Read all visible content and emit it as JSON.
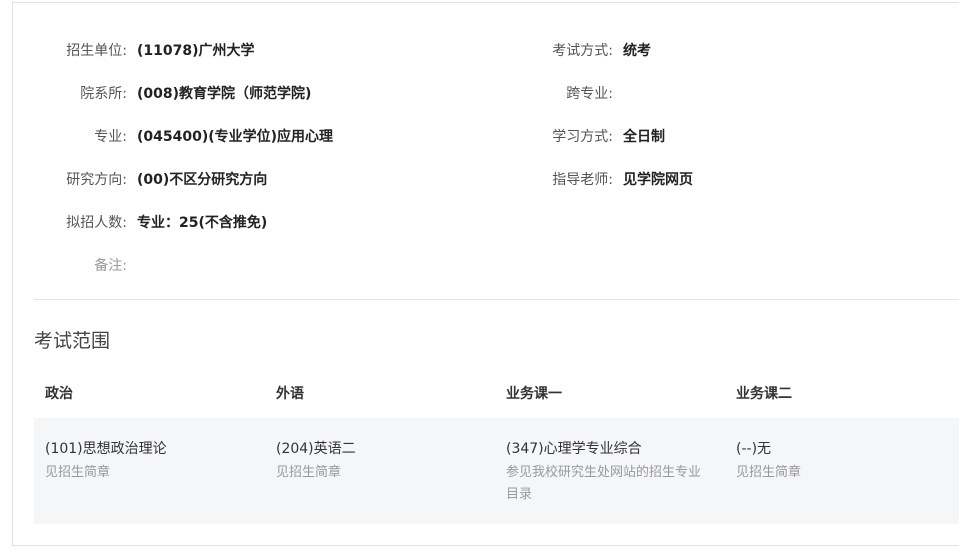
{
  "info": {
    "left": [
      {
        "label": "招生单位:",
        "value": "(11078)广州大学"
      },
      {
        "label": "院系所:",
        "value": "(008)教育学院（师范学院)"
      },
      {
        "label": "专业:",
        "value": "(045400)(专业学位)应用心理"
      },
      {
        "label": "研究方向:",
        "value": "(00)不区分研究方向"
      },
      {
        "label": "拟招人数:",
        "value": "专业：25(不含推免)"
      },
      {
        "label": "备注:",
        "value": ""
      }
    ],
    "right": [
      {
        "label": "考试方式:",
        "value": "统考"
      },
      {
        "label": "跨专业:",
        "value": ""
      },
      {
        "label": "学习方式:",
        "value": "全日制"
      },
      {
        "label": "指导老师:",
        "value": "见学院网页"
      }
    ]
  },
  "exam_scope": {
    "title": "考试范围",
    "headers": [
      "政治",
      "外语",
      "业务课一",
      "业务课二"
    ],
    "rows": [
      [
        {
          "subject": "(101)思想政治理论",
          "note": "见招生简章"
        },
        {
          "subject": "(204)英语二",
          "note": "见招生简章"
        },
        {
          "subject": "(347)心理学专业综合",
          "note": "参见我校研究生处网站的招生专业目录"
        },
        {
          "subject": "(--)无",
          "note": "见招生简章"
        }
      ]
    ]
  }
}
